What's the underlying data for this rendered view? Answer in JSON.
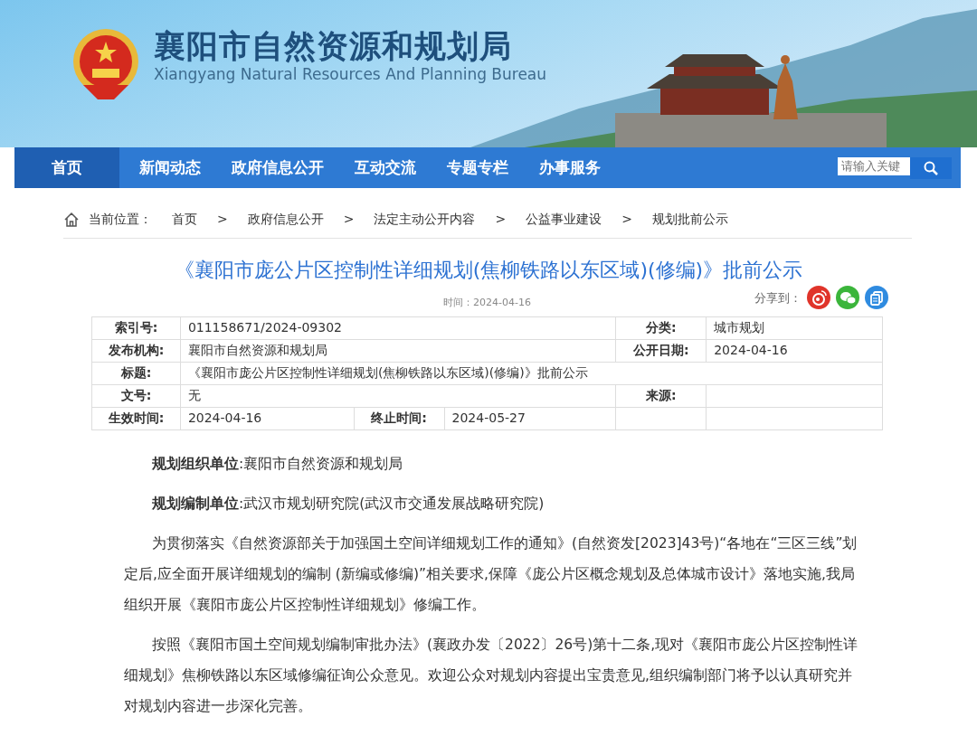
{
  "header": {
    "title": "襄阳市自然资源和规划局",
    "subtitle": "Xiangyang Natural Resources And Planning Bureau"
  },
  "nav": {
    "items": [
      {
        "label": "首页",
        "selected": true
      },
      {
        "label": "新闻动态",
        "selected": false
      },
      {
        "label": "政府信息公开",
        "selected": false
      },
      {
        "label": "互动交流",
        "selected": false
      },
      {
        "label": "专题专栏",
        "selected": false
      },
      {
        "label": "办事服务",
        "selected": false
      }
    ],
    "search": {
      "placeholder": "请输入关键"
    }
  },
  "breadcrumb": {
    "label": "当前位置：",
    "items": [
      "首页",
      "政府信息公开",
      "法定主动公开内容",
      "公益事业建设",
      "规划批前公示"
    ],
    "separator": ">"
  },
  "article": {
    "title": "《襄阳市庞公片区控制性详细规划(焦柳铁路以东区域)(修编)》批前公示",
    "time": "时间：2024-04-16",
    "share_label": "分享到："
  },
  "info_table": {
    "rows": [
      [
        {
          "kind": "label",
          "text": "索引号:"
        },
        {
          "kind": "value",
          "text": "011158671/2024-09302",
          "colspan": 3
        },
        {
          "kind": "label",
          "text": "分类:"
        },
        {
          "kind": "value",
          "text": "城市规划"
        }
      ],
      [
        {
          "kind": "label",
          "text": "发布机构:"
        },
        {
          "kind": "value",
          "text": "襄阳市自然资源和规划局",
          "colspan": 3
        },
        {
          "kind": "label",
          "text": "公开日期:"
        },
        {
          "kind": "value",
          "text": "2024-04-16"
        }
      ],
      [
        {
          "kind": "label",
          "text": "标题:"
        },
        {
          "kind": "value",
          "text": "《襄阳市庞公片区控制性详细规划(焦柳铁路以东区域)(修编)》批前公示",
          "colspan": 5
        }
      ],
      [
        {
          "kind": "label",
          "text": "文号:"
        },
        {
          "kind": "value",
          "text": "无",
          "colspan": 3
        },
        {
          "kind": "label",
          "text": "来源:"
        },
        {
          "kind": "blank"
        }
      ],
      [
        {
          "kind": "label",
          "text": "生效时间:"
        },
        {
          "kind": "value",
          "text": "2024-04-16"
        },
        {
          "kind": "label",
          "text": "终止时间:"
        },
        {
          "kind": "value",
          "text": "2024-05-27"
        },
        {
          "kind": "blank"
        },
        {
          "kind": "blank"
        }
      ]
    ]
  },
  "paragraphs": [
    "**规划组织单位**:襄阳市自然资源和规划局",
    "**规划编制单位**:武汉市规划研究院(武汉市交通发展战略研究院)",
    "为贯彻落实《自然资源部关于加强国土空间详细规划工作的通知》(自然资发[2023]43号)“各地在“三区三线”划定后,应全面开展详细规划的编制 (新编或修编)”相关要求,保障《庞公片区概念规划及总体城市设计》落地实施,我局组织开展《襄阳市庞公片区控制性详细规划》修编工作。",
    "按照《襄阳市国土空间规划编制审批办法》(襄政办发〔2022〕26号)第十二条,现对《襄阳市庞公片区控制性详细规划》焦柳铁路以东区域修编征询公众意见。欢迎公众对规划内容提出宝贵意见,组织编制部门将予以认真研究并对规划内容进一步深化完善。"
  ]
}
